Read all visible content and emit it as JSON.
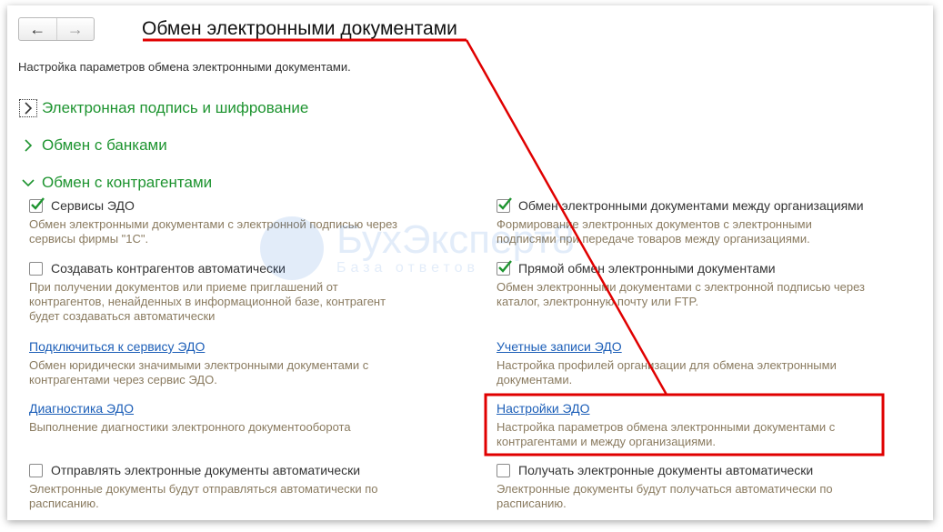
{
  "nav": {
    "back_icon": "arrow-left-icon",
    "forward_icon": "arrow-right-icon"
  },
  "header": {
    "title": "Обмен электронными документами",
    "description": "Настройка параметров обмена электронными документами."
  },
  "groups": {
    "signature": {
      "label": "Электронная подпись и шифрование",
      "state": "collapsed"
    },
    "banks": {
      "label": "Обмен с банками",
      "state": "collapsed"
    },
    "contractors": {
      "label": "Обмен с контрагентами",
      "state": "expanded"
    }
  },
  "left": {
    "services": {
      "label": "Сервисы ЭДО",
      "checked": true,
      "desc1": "Обмен электронными документами с электронной подписью через",
      "desc2": "сервисы фирмы \"1С\"."
    },
    "create_auto": {
      "label": "Создавать контрагентов автоматически",
      "checked": false,
      "desc1": "При получении документов или приеме приглашений от",
      "desc2": "контрагентов, ненайденных в информационной базе, контрагент",
      "desc3": "будет создаваться автоматически"
    },
    "connect": {
      "label": "Подключиться к сервису ЭДО",
      "desc1": "Обмен юридически значимыми электронными документами с",
      "desc2": "контрагентами через сервис ЭДО."
    },
    "diagnostics": {
      "label": "Диагностика ЭДО",
      "desc1": "Выполнение диагностики электронного документооборота"
    },
    "send_auto": {
      "label": "Отправлять электронные документы автоматически",
      "checked": false,
      "desc1": "Электронные документы будут отправляться автоматически по",
      "desc2": "расписанию."
    }
  },
  "right": {
    "between_orgs": {
      "label": "Обмен электронными документами между организациями",
      "checked": true,
      "desc1": "Формирование электронных документов с электронными",
      "desc2": "подписями при передаче товаров между организациями."
    },
    "direct": {
      "label": "Прямой обмен электронными документами",
      "checked": true,
      "desc1": "Обмен электронными документами с электронной подписью через",
      "desc2": "каталог, электронную почту или FTP."
    },
    "accounts": {
      "label": "Учетные записи ЭДО",
      "desc1": "Настройка профилей организации для обмена электронными",
      "desc2": "документами."
    },
    "settings": {
      "label": "Настройки ЭДО",
      "desc1": "Настройка параметров обмена электронными документами с",
      "desc2": "контрагентами и между организациями."
    },
    "receive_auto": {
      "label": "Получать электронные документы автоматически",
      "checked": false,
      "desc1": "Электронные документы будут получаться автоматически по",
      "desc2": "расписанию."
    }
  },
  "watermark": {
    "brand": "БухЭксперт8",
    "tagline": "База ответов"
  },
  "colors": {
    "group_green": "#1e9430",
    "link_blue": "#1d5fb8",
    "desc_brown": "#8a7b60",
    "annotation_red": "#e00000"
  }
}
